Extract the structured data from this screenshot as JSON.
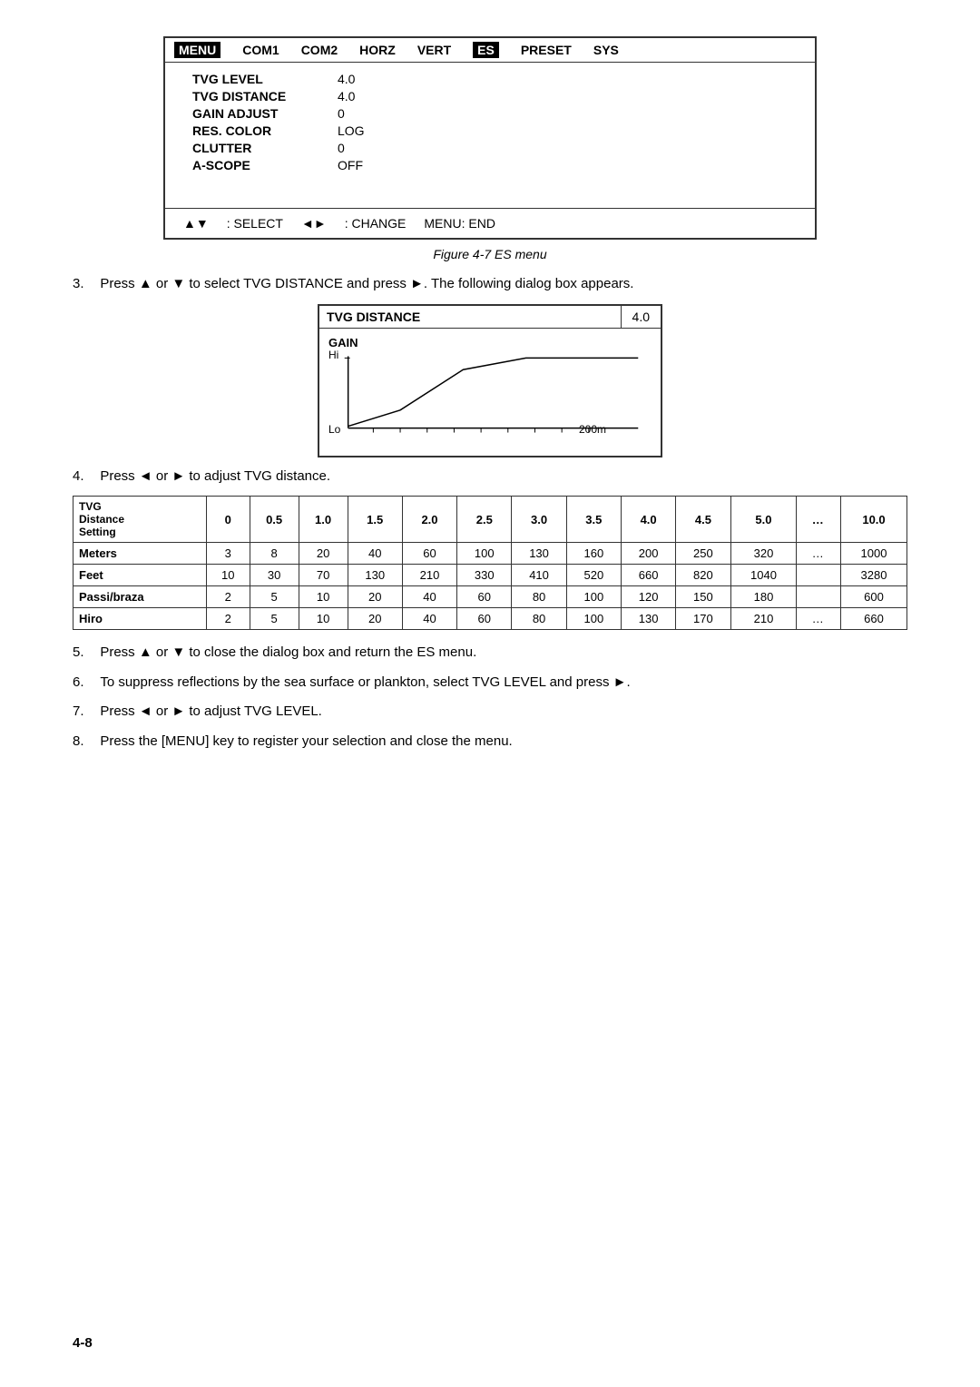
{
  "menu": {
    "tabs": [
      "MENU",
      "COM1",
      "COM2",
      "HORZ",
      "VERT",
      "ES",
      "PRESET",
      "SYS"
    ],
    "active_tab": "MENU",
    "highlighted_tab": "ES",
    "rows": [
      {
        "label": "TVG LEVEL",
        "value": "4.0"
      },
      {
        "label": "TVG DISTANCE",
        "value": "4.0"
      },
      {
        "label": "GAIN ADJUST",
        "value": "0"
      },
      {
        "label": "RES. COLOR",
        "value": "LOG"
      },
      {
        "label": "CLUTTER",
        "value": "0"
      },
      {
        "label": "A-SCOPE",
        "value": "OFF"
      }
    ],
    "footer": {
      "select_text": ": SELECT",
      "change_text": ": CHANGE",
      "end_text": "MENU: END"
    }
  },
  "figure_caption": "Figure 4-7 ES menu",
  "steps": [
    {
      "num": "3.",
      "text": "Press ▲ or ▼ to select TVG DISTANCE and press ►. The following dialog box appears."
    },
    {
      "num": "4.",
      "text": "Press ◄ or ► to adjust TVG distance."
    },
    {
      "num": "5.",
      "text": "Press ▲ or ▼ to close the dialog box and return the ES menu."
    },
    {
      "num": "6.",
      "text": "To suppress reflections by the sea surface or plankton, select TVG LEVEL and press ►."
    },
    {
      "num": "7.",
      "text": "Press ◄ or ► to adjust TVG LEVEL."
    },
    {
      "num": "8.",
      "text": "Press the [MENU] key to register your selection and close the menu."
    }
  ],
  "dialog": {
    "title": "TVG DISTANCE",
    "value": "4.0",
    "chart": {
      "gain_label": "GAIN",
      "hi_label": "Hi",
      "lo_label": "Lo",
      "distance_label": "200m"
    }
  },
  "table": {
    "headers": [
      "TVG\nDistance\nSetting",
      "0",
      "0.5",
      "1.0",
      "1.5",
      "2.0",
      "2.5",
      "3.0",
      "3.5",
      "4.0",
      "4.5",
      "5.0",
      "....",
      "10.0"
    ],
    "rows": [
      {
        "label": "Meters",
        "values": [
          "3",
          "8",
          "20",
          "40",
          "60",
          "100",
          "130",
          "160",
          "200",
          "250",
          "320",
          "....",
          "1000"
        ]
      },
      {
        "label": "Feet",
        "values": [
          "10",
          "30",
          "70",
          "130",
          "210",
          "330",
          "410",
          "520",
          "660",
          "820",
          "1040",
          "",
          "3280"
        ]
      },
      {
        "label": "Passi/braza",
        "values": [
          "2",
          "5",
          "10",
          "20",
          "40",
          "60",
          "80",
          "100",
          "120",
          "150",
          "180",
          "",
          "600"
        ]
      },
      {
        "label": "Hiro",
        "values": [
          "2",
          "5",
          "10",
          "20",
          "40",
          "60",
          "80",
          "100",
          "130",
          "170",
          "210",
          "....",
          "660"
        ]
      }
    ]
  },
  "page_number": "4-8"
}
